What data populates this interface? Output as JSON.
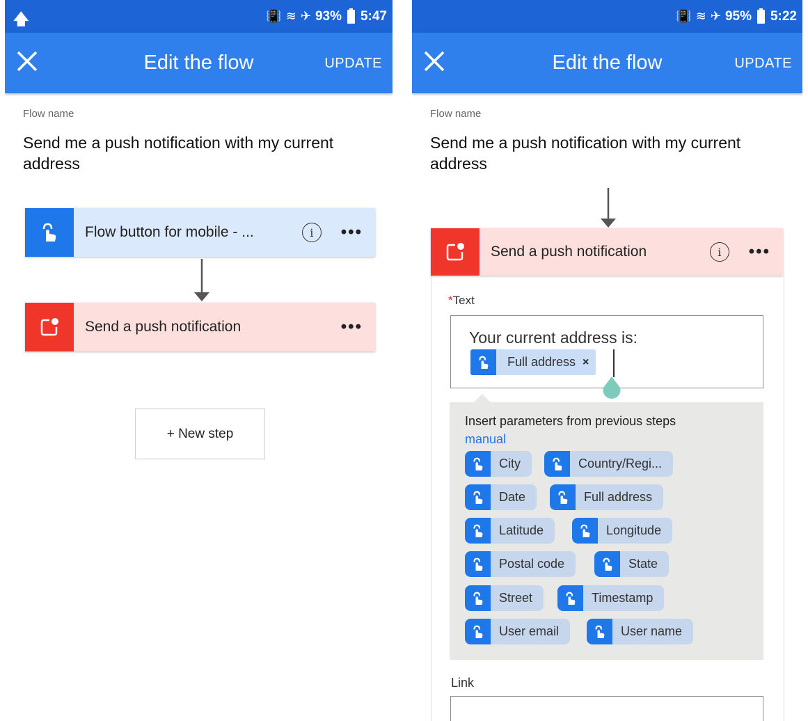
{
  "colors": {
    "status_bar": "#1d64d6",
    "app_bar": "#2f80ed",
    "trigger_accent": "#1f78ea",
    "trigger_bg": "#dbe9fc",
    "action_accent": "#f0352b",
    "action_bg": "#fde0de",
    "link": "#1f78ea"
  },
  "left": {
    "status": {
      "battery": "93%",
      "time": "5:47",
      "upload_icon": "upload-arrow-icon"
    },
    "header": {
      "close_icon": "close-icon",
      "title": "Edit the flow",
      "update_label": "UPDATE"
    },
    "flow_name_label": "Flow name",
    "flow_name": "Send me a push notification with my current address",
    "trigger": {
      "label": "Flow button for mobile - ...",
      "icon": "touch-button-icon",
      "info": "i",
      "more": "•••"
    },
    "action": {
      "label": "Send a push notification",
      "icon": "notification-icon",
      "more": "•••"
    },
    "new_step_label": "+ New step"
  },
  "right": {
    "status": {
      "battery": "95%",
      "time": "5:22"
    },
    "header": {
      "close_icon": "close-icon",
      "title": "Edit the flow",
      "update_label": "UPDATE"
    },
    "flow_name_label": "Flow name",
    "flow_name": "Send me a push notification with my current address",
    "action": {
      "label": "Send a push notification",
      "icon": "notification-icon",
      "info": "i",
      "more": "•••"
    },
    "text_field": {
      "required_mark": "*",
      "label": "Text",
      "value_line": "Your current address is:",
      "token": "Full address",
      "token_remove": "×"
    },
    "params": {
      "title": "Insert parameters from previous steps",
      "source": "manual",
      "chips": [
        "City",
        "Country/Regi...",
        "Date",
        "Full address",
        "Latitude",
        "Longitude",
        "Postal code",
        "State",
        "Street",
        "Timestamp",
        "User email",
        "User name"
      ]
    },
    "link_label": "Link"
  }
}
